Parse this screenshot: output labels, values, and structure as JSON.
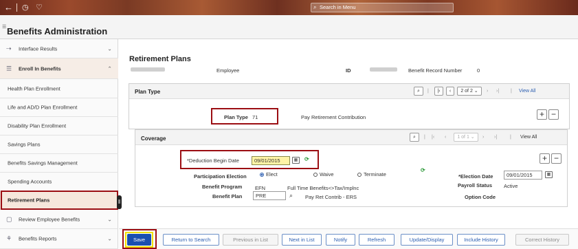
{
  "topbar": {
    "search_placeholder": "Search in Menu"
  },
  "title": {
    "app_title": "Benefits Administration",
    "menu_glyph": "☰"
  },
  "sidebar": {
    "items": [
      {
        "label": "Interface Results"
      },
      {
        "label": "Enroll In Benefits"
      },
      {
        "label": "Health Plan Enrollment"
      },
      {
        "label": "Life and AD/D Plan Enrollment"
      },
      {
        "label": "Disability Plan Enrollment"
      },
      {
        "label": "Savings Plans"
      },
      {
        "label": "Benefits Savings Management"
      },
      {
        "label": "Spending Accounts"
      },
      {
        "label": "Retirement Plans"
      },
      {
        "label": "Review Employee Benefits"
      },
      {
        "label": "Benefits Reports"
      }
    ]
  },
  "main": {
    "page_title": "Retirement Plans",
    "employee_label": "Employee",
    "id_label": "ID",
    "benefit_record_label": "Benefit Record Number",
    "benefit_record_value": "0"
  },
  "plan_type_panel": {
    "title": "Plan Type",
    "pager": "2 of 2",
    "view_all": "View All",
    "plan_type_label": "Plan Type",
    "plan_type_value": "71",
    "plan_type_desc": "Pay Retirement Contribution"
  },
  "coverage_panel": {
    "title": "Coverage",
    "pager": "1 of 1",
    "view_all": "View All",
    "deduction_begin_label": "*Deduction Begin Date",
    "deduction_begin_value": "09/01/2015",
    "participation_label": "Participation Election",
    "elect_label": "Elect",
    "waive_label": "Waive",
    "terminate_label": "Terminate",
    "election_date_label": "*Election Date",
    "election_date_value": "09/01/2015",
    "benefit_program_label": "Benefit Program",
    "benefit_program_value": "EFN",
    "benefit_program_desc": "Full Time Benefits<>Tax/Implnc",
    "payroll_status_label": "Payroll Status",
    "payroll_status_value": "Active",
    "benefit_plan_label": "Benefit Plan",
    "benefit_plan_value": "PRE",
    "benefit_plan_desc": "Pay Ret Contrib - ERS",
    "option_code_label": "Option Code"
  },
  "footer": {
    "save": "Save",
    "return_to_search": "Return to Search",
    "previous_in_list": "Previous in List",
    "next_in_list": "Next in List",
    "notify": "Notify",
    "refresh": "Refresh",
    "update_display": "Update/Display",
    "include_history": "Include History",
    "correct_history": "Correct History"
  },
  "colors": {
    "accent": "#2a5db0",
    "highlight_box": "#9b0d12",
    "save_ring": "#f1e100"
  }
}
